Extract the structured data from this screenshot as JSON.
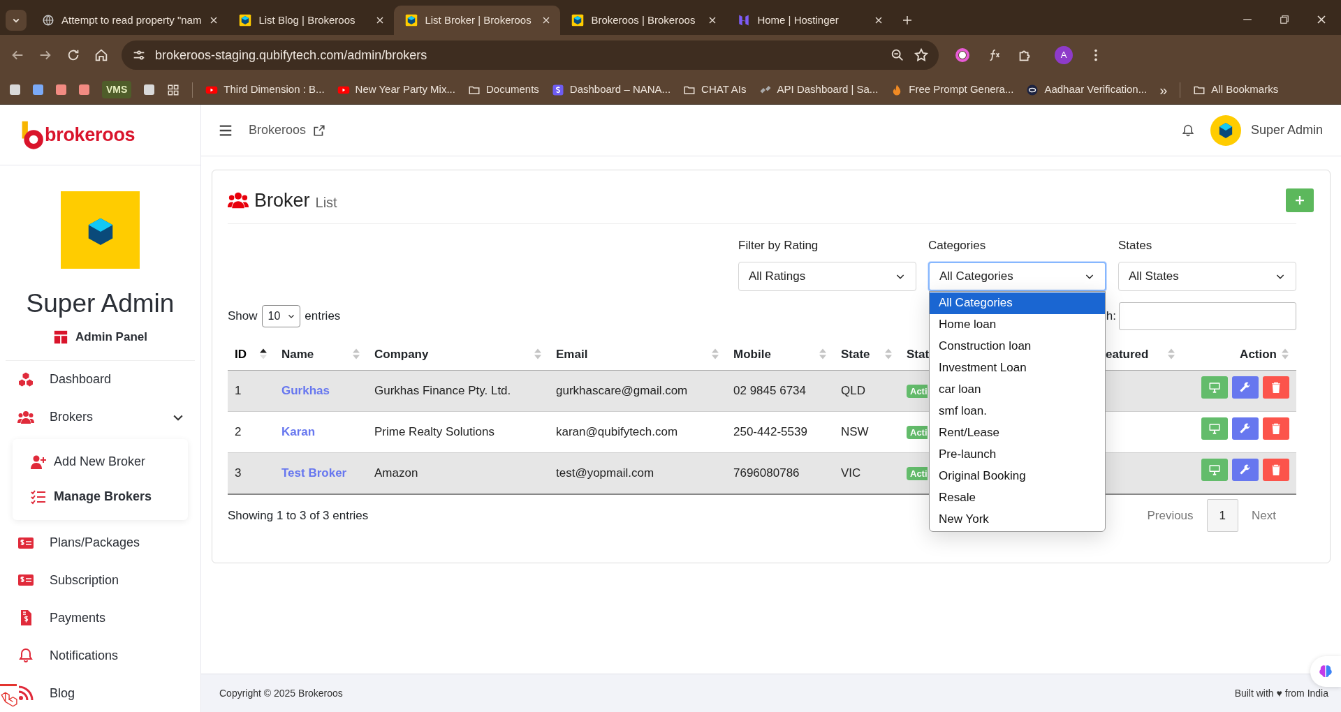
{
  "browser": {
    "tabs": [
      {
        "title": "Attempt to read property \"nam",
        "selected": false
      },
      {
        "title": "List Blog | Brokeroos",
        "selected": false
      },
      {
        "title": "List Broker | Brokeroos",
        "selected": true
      },
      {
        "title": "Brokeroos | Brokeroos",
        "selected": false
      },
      {
        "title": "Home | Hostinger",
        "selected": false
      }
    ],
    "url": "brokeroos-staging.qubifytech.com/admin/brokers",
    "profile_initial": "A",
    "bookmarks": [
      {
        "kind": "square",
        "color": "#d9d9d9"
      },
      {
        "kind": "square",
        "color": "#7baaf7"
      },
      {
        "kind": "square",
        "color": "#f28b82"
      },
      {
        "kind": "square",
        "color": "#f28b82"
      },
      {
        "kind": "chip",
        "label": "VMS"
      },
      {
        "kind": "square",
        "color": "#d9d9d9"
      },
      {
        "kind": "apps"
      },
      {
        "kind": "link",
        "label": "Third Dimension : B..."
      },
      {
        "kind": "link",
        "label": "New Year Party Mix..."
      },
      {
        "kind": "link",
        "label": "Documents"
      },
      {
        "kind": "link",
        "label": "Dashboard – NANA..."
      },
      {
        "kind": "link",
        "label": "CHAT AIs"
      },
      {
        "kind": "link",
        "label": "API Dashboard | Sa..."
      },
      {
        "kind": "link",
        "label": "Free Prompt Genera..."
      },
      {
        "kind": "link",
        "label": "Aadhaar Verification..."
      },
      {
        "kind": "more",
        "label": "»"
      },
      {
        "kind": "link",
        "label": "All Bookmarks"
      }
    ]
  },
  "sidebar": {
    "brand": "brokeroos",
    "user_name": "Super Admin",
    "role": "Admin Panel",
    "menu": [
      {
        "label": "Dashboard"
      },
      {
        "label": "Brokers",
        "expanded": true,
        "children": [
          {
            "label": "Add New Broker",
            "selected": false
          },
          {
            "label": "Manage Brokers",
            "selected": true
          }
        ]
      },
      {
        "label": "Plans/Packages"
      },
      {
        "label": "Subscription"
      },
      {
        "label": "Payments"
      },
      {
        "label": "Notifications"
      },
      {
        "label": "Blog"
      }
    ]
  },
  "header": {
    "site_link": "Brokeroos",
    "user_name": "Super Admin"
  },
  "card": {
    "title": "Broker",
    "subtitle": "List",
    "filters": [
      {
        "label": "Filter by Rating",
        "value": "All Ratings",
        "open": false
      },
      {
        "label": "Categories",
        "value": "All Categories",
        "open": true,
        "options": [
          {
            "label": "All Categories",
            "selected": true
          },
          {
            "label": "Home loan",
            "selected": false
          },
          {
            "label": "Construction loan",
            "selected": false
          },
          {
            "label": "Investment Loan",
            "selected": false
          },
          {
            "label": "car loan",
            "selected": false
          },
          {
            "label": "smf loan.",
            "selected": false
          },
          {
            "label": "Rent/Lease",
            "selected": false
          },
          {
            "label": "Pre-launch",
            "selected": false
          },
          {
            "label": "Original Booking",
            "selected": false
          },
          {
            "label": "Resale",
            "selected": false
          },
          {
            "label": "New York",
            "selected": false
          }
        ]
      },
      {
        "label": "States",
        "value": "All States",
        "open": false
      }
    ],
    "length": {
      "before": "Show",
      "value": "10",
      "after": "entries"
    },
    "search_label": "h:",
    "table": {
      "columns": [
        {
          "label": "ID",
          "sortable": true,
          "sorted": true
        },
        {
          "label": "Name",
          "sortable": true,
          "sorted": false
        },
        {
          "label": "Company",
          "sortable": true,
          "sorted": false
        },
        {
          "label": "Email",
          "sortable": true,
          "sorted": false
        },
        {
          "label": "Mobile",
          "sortable": true,
          "sorted": false
        },
        {
          "label": "State",
          "sortable": true,
          "sorted": false
        },
        {
          "label": "Stat",
          "sortable": false
        },
        {
          "label": "eatured",
          "sortable": true,
          "sorted": false
        },
        {
          "label": "Action",
          "sortable": true,
          "sorted": false
        }
      ],
      "rows": [
        {
          "id": "1",
          "name": "Gurkhas",
          "company": "Gurkhas Finance Pty. Ltd.",
          "email": "gurkhascare@gmail.com",
          "mobile": "02 9845 6734",
          "state": "QLD",
          "status": "Acti"
        },
        {
          "id": "2",
          "name": "Karan",
          "company": "Prime Realty Solutions",
          "email": "karan@qubifytech.com",
          "mobile": "250-442-5539",
          "state": "NSW",
          "status": "Acti"
        },
        {
          "id": "3",
          "name": "Test Broker",
          "company": "Amazon",
          "email": "test@yopmail.com",
          "mobile": "7696080786",
          "state": "VIC",
          "status": "Acti"
        }
      ]
    },
    "info": "Showing 1 to 3 of 3 entries",
    "pagination": [
      {
        "label": "Previous",
        "selected": false,
        "disabled": true
      },
      {
        "label": "1",
        "selected": true,
        "disabled": false
      },
      {
        "label": "Next",
        "selected": false,
        "disabled": true
      }
    ]
  },
  "footer": {
    "copyright": "Copyright © 2025",
    "copyright_link": "Brokeroos",
    "built": "Built with ♥ from India"
  }
}
